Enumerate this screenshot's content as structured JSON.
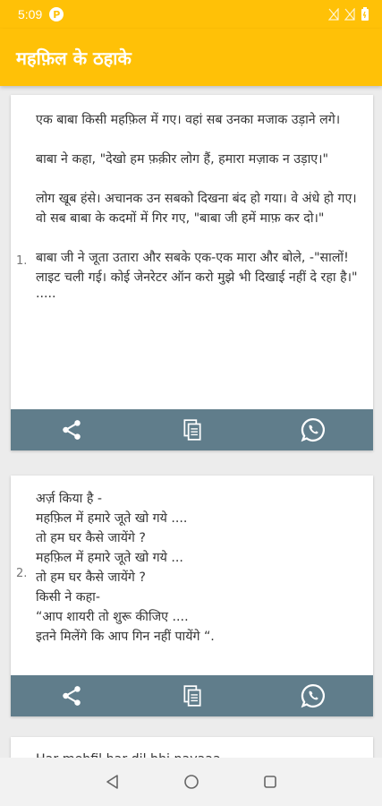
{
  "status_bar": {
    "time": "5:09",
    "app_badge": "P"
  },
  "app_bar": {
    "title": "महफ़िल के ठहाके"
  },
  "cards": [
    {
      "number": "1.",
      "paragraphs": [
        "एक बाबा किसी महफ़िल में गए। वहां सब उनका मजाक उड़ाने लगे।",
        "बाबा ने कहा, \"देखो हम फ़क़ीर लोग हैं, हमारा मज़ाक न उड़ाए।\"",
        "लोग खूब हंसे। अचानक उन सबको दिखना बंद हो गया। वे अंधे हो गए। वो सब बाबा के कदमों में गिर गए, \"बाबा जी हमें माफ़ कर दो।\"",
        "बाबा जी ने जूता उतारा और सबके एक-एक मारा और बोले, -\"सालों! लाइट चली गई। कोई जेनरेटर ऑन करो मुझे भी दिखाई नहीं दे रहा है।\""
      ],
      "ellipsis": "....."
    },
    {
      "number": "2.",
      "lines": [
        "अर्ज़ किया है -",
        "महफ़िल में हमारे जूते खो गये ....",
        "तो हम घर कैसे जायेंगे ?",
        "महफ़िल में हमारे जूते खो गये ...",
        "तो हम घर कैसे जायेंगे ?",
        "किसी ने कहा-",
        "“आप शायरी तो शुरू कीजिए ....",
        "इतने मिलेंगे कि आप गिन नहीं पायेंगे “."
      ]
    },
    {
      "first_line": "Har mehfil har dil bhi nayaaa"
    }
  ],
  "icons": {
    "share": "share-icon",
    "copy": "copy-icon",
    "whatsapp": "whatsapp-icon",
    "back": "back-icon",
    "home": "home-icon",
    "recents": "recents-icon"
  },
  "colors": {
    "accent": "#ffc107",
    "action_bar": "#607d8b",
    "background": "#ececec"
  }
}
